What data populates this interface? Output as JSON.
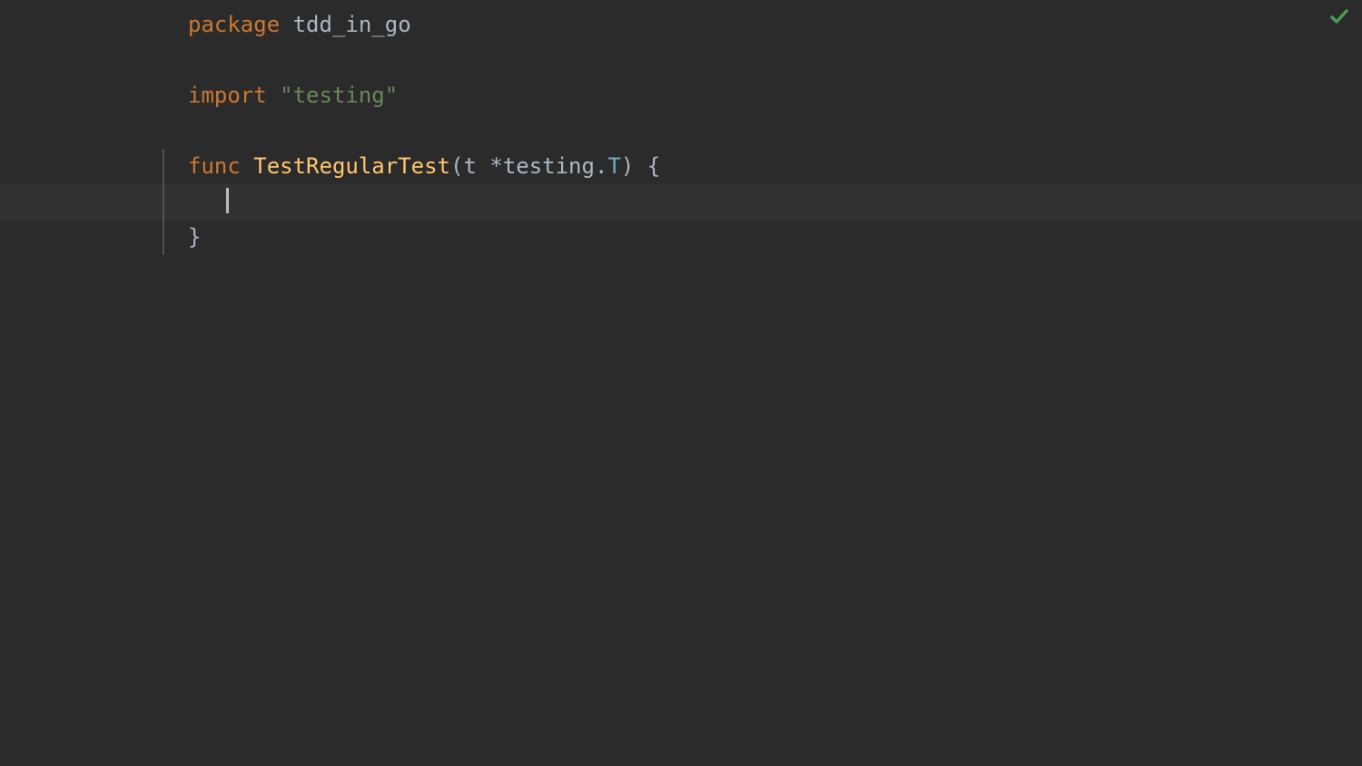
{
  "code": {
    "line1": {
      "keyword": "package",
      "identifier": " tdd_in_go"
    },
    "line3": {
      "keyword": "import",
      "string": " \"testing\""
    },
    "line5": {
      "keyword": "func",
      "space1": " ",
      "funcName": "TestRegularTest",
      "paren_open": "(",
      "param": "t ",
      "star": "*",
      "pkg": "testing",
      "dot": ".",
      "type": "T",
      "paren_close": ")",
      "brace": " {"
    },
    "line7": {
      "brace": "}"
    }
  },
  "status": {
    "icon": "checkmark"
  }
}
